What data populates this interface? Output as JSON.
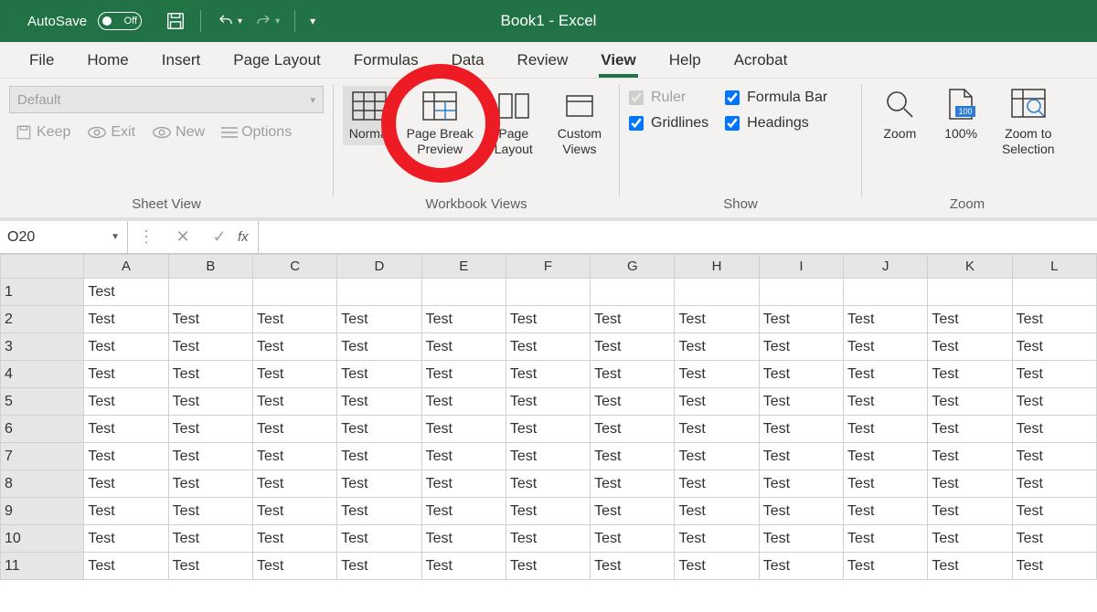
{
  "title_bar": {
    "autosave_label": "AutoSave",
    "autosave_state": "Off",
    "app_title": "Book1  -  Excel"
  },
  "tabs": [
    "File",
    "Home",
    "Insert",
    "Page Layout",
    "Formulas",
    "Data",
    "Review",
    "View",
    "Help",
    "Acrobat"
  ],
  "active_tab": "View",
  "ribbon": {
    "sheet_view": {
      "dropdown_value": "Default",
      "keep": "Keep",
      "exit": "Exit",
      "new": "New",
      "options": "Options",
      "group_label": "Sheet View"
    },
    "workbook_views": {
      "normal": "Normal",
      "page_break": "Page Break Preview",
      "page_layout": "Page Layout",
      "custom": "Custom Views",
      "group_label": "Workbook Views"
    },
    "show": {
      "ruler": "Ruler",
      "formula_bar": "Formula Bar",
      "gridlines": "Gridlines",
      "headings": "Headings",
      "group_label": "Show"
    },
    "zoom": {
      "zoom": "Zoom",
      "hundred": "100%",
      "selection": "Zoom to Selection",
      "group_label": "Zoom"
    }
  },
  "formula_bar": {
    "name_box": "O20",
    "fx": "fx",
    "value": ""
  },
  "columns": [
    "A",
    "B",
    "C",
    "D",
    "E",
    "F",
    "G",
    "H",
    "I",
    "J",
    "K",
    "L"
  ],
  "rows": [
    {
      "n": 1,
      "cells": [
        "Test",
        "",
        "",
        "",
        "",
        "",
        "",
        "",
        "",
        "",
        "",
        ""
      ]
    },
    {
      "n": 2,
      "cells": [
        "Test",
        "Test",
        "Test",
        "Test",
        "Test",
        "Test",
        "Test",
        "Test",
        "Test",
        "Test",
        "Test",
        "Test"
      ]
    },
    {
      "n": 3,
      "cells": [
        "Test",
        "Test",
        "Test",
        "Test",
        "Test",
        "Test",
        "Test",
        "Test",
        "Test",
        "Test",
        "Test",
        "Test"
      ]
    },
    {
      "n": 4,
      "cells": [
        "Test",
        "Test",
        "Test",
        "Test",
        "Test",
        "Test",
        "Test",
        "Test",
        "Test",
        "Test",
        "Test",
        "Test"
      ]
    },
    {
      "n": 5,
      "cells": [
        "Test",
        "Test",
        "Test",
        "Test",
        "Test",
        "Test",
        "Test",
        "Test",
        "Test",
        "Test",
        "Test",
        "Test"
      ]
    },
    {
      "n": 6,
      "cells": [
        "Test",
        "Test",
        "Test",
        "Test",
        "Test",
        "Test",
        "Test",
        "Test",
        "Test",
        "Test",
        "Test",
        "Test"
      ]
    },
    {
      "n": 7,
      "cells": [
        "Test",
        "Test",
        "Test",
        "Test",
        "Test",
        "Test",
        "Test",
        "Test",
        "Test",
        "Test",
        "Test",
        "Test"
      ]
    },
    {
      "n": 8,
      "cells": [
        "Test",
        "Test",
        "Test",
        "Test",
        "Test",
        "Test",
        "Test",
        "Test",
        "Test",
        "Test",
        "Test",
        "Test"
      ]
    },
    {
      "n": 9,
      "cells": [
        "Test",
        "Test",
        "Test",
        "Test",
        "Test",
        "Test",
        "Test",
        "Test",
        "Test",
        "Test",
        "Test",
        "Test"
      ]
    },
    {
      "n": 10,
      "cells": [
        "Test",
        "Test",
        "Test",
        "Test",
        "Test",
        "Test",
        "Test",
        "Test",
        "Test",
        "Test",
        "Test",
        "Test"
      ]
    },
    {
      "n": 11,
      "cells": [
        "Test",
        "Test",
        "Test",
        "Test",
        "Test",
        "Test",
        "Test",
        "Test",
        "Test",
        "Test",
        "Test",
        "Test"
      ]
    }
  ]
}
